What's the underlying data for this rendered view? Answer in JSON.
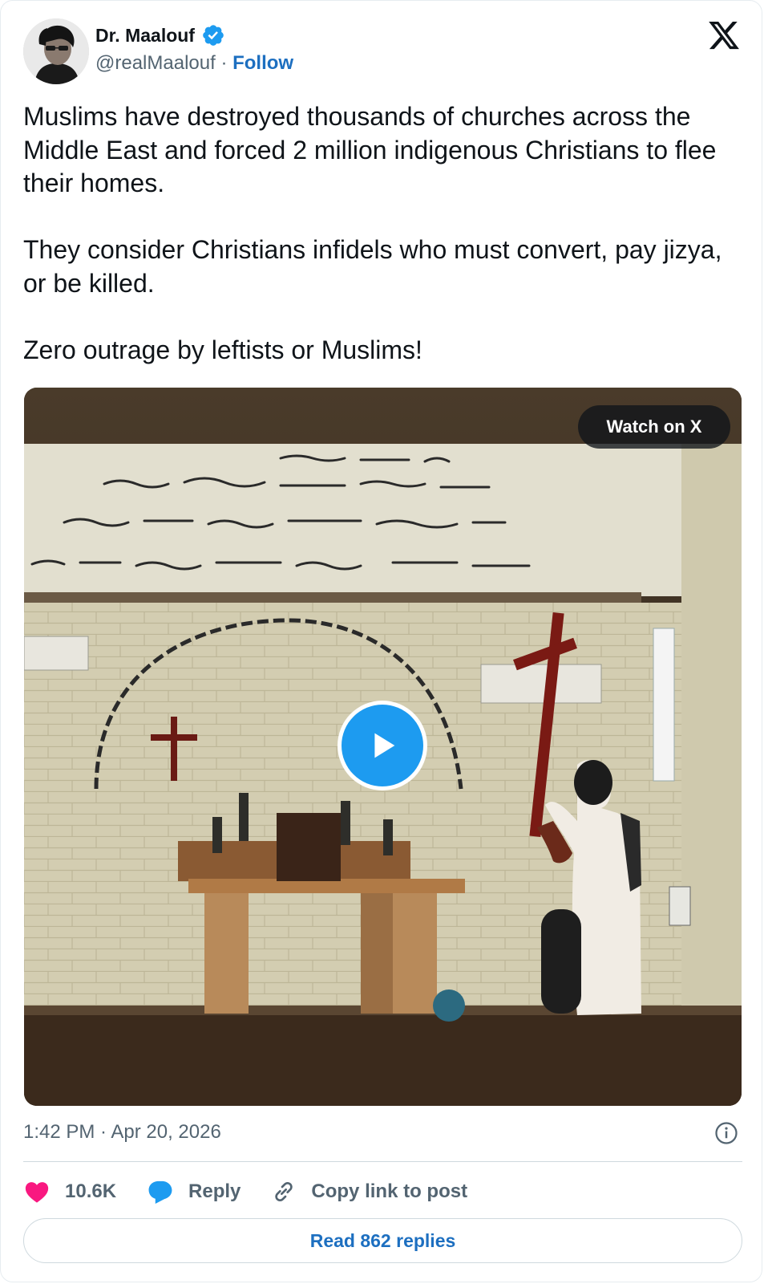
{
  "author": {
    "name": "Dr. Maalouf",
    "handle": "@realMaalouf",
    "separator": "·",
    "follow_label": "Follow",
    "verified_icon": "verified-badge-icon",
    "avatar": "avatar"
  },
  "brand_icon": "x-logo-icon",
  "tweet": {
    "paragraphs": [
      "Muslims have destroyed thousands of churches across the Middle East and forced 2 million indigenous Christians to flee their homes.",
      "They consider Christians infidels who must convert, pay jizya, or be killed.",
      "Zero outrage by leftists or Muslims!"
    ]
  },
  "media": {
    "watch_label": "Watch on X",
    "play_icon": "play-icon"
  },
  "meta": {
    "timestamp": "1:42 PM · Apr 20, 2026",
    "info_icon": "info-icon"
  },
  "actions": {
    "like_count": "10.6K",
    "reply_label": "Reply",
    "copy_label": "Copy link to post"
  },
  "read_replies_label": "Read 862 replies",
  "colors": {
    "accent": "#1d9bf0",
    "link": "#1d6fc0",
    "like": "#f91880",
    "muted": "#536471",
    "text": "#0f1419"
  }
}
